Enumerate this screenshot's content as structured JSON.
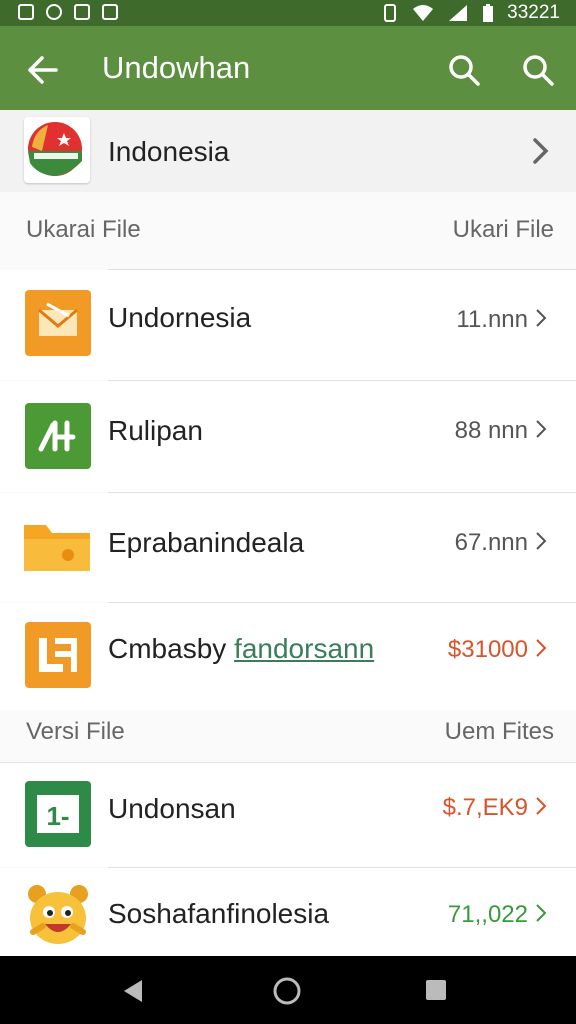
{
  "status_bar": {
    "left_icons": [
      "gmail-icon",
      "record-icon",
      "photo-icon",
      "image-icon"
    ],
    "time": "33221"
  },
  "app_bar": {
    "title": "Undowhan"
  },
  "country": {
    "name": "Indonesia"
  },
  "sections": [
    {
      "left": "Ukarai File",
      "right": "Ukari File"
    },
    {
      "left": "Versi File",
      "right": "Uem Fites"
    }
  ],
  "rows": [
    {
      "label": "Undornesia",
      "value": "11.nnn",
      "value_color": "#555555",
      "icon": "mail-icon",
      "icon_bg": "#f29a26"
    },
    {
      "label": "Rulipan",
      "value": "88 nnn",
      "value_color": "#555555",
      "icon": "edit-icon",
      "icon_bg": "#4c9a36"
    },
    {
      "label": "Eprabanindeala",
      "value": "67.nnn",
      "value_color": "#555555",
      "icon": "folder-icon",
      "icon_bg": "#f5a623"
    },
    {
      "label_main": "Cmbasby",
      "label_link": "fandorsann",
      "value": "$31000",
      "value_color": "#d9532b",
      "icon": "document-icon",
      "icon_bg": "#f29a26"
    },
    {
      "label": "Undonsan",
      "value": "$.7,EK9",
      "value_color": "#d9532b",
      "icon": "number-icon",
      "icon_bg": "#2e8b47"
    },
    {
      "label": "Soshafanfinolesia",
      "value": "71,,022",
      "value_color": "#3a9a3a",
      "icon": "mascot-icon",
      "icon_bg": "#f7c23a"
    }
  ],
  "colors": {
    "status_bar": "#3e6b2b",
    "app_bar": "#5c8f3f",
    "nav_bar": "#000000"
  }
}
